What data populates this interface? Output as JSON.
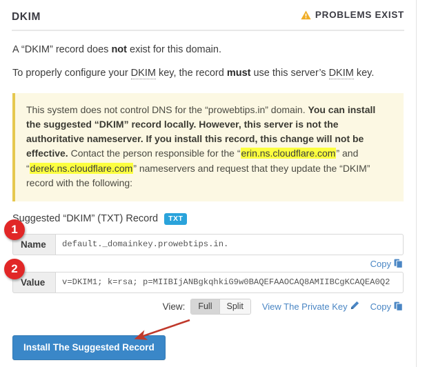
{
  "header": {
    "title": "DKIM",
    "status_label": "PROBLEMS EXIST",
    "status_icon": "warning-triangle-icon",
    "status_color": "#f0ad26"
  },
  "intro": {
    "line1_a": "A “DKIM” record does ",
    "line1_bold": "not",
    "line1_b": " exist for this domain.",
    "line2_a": "To properly configure your ",
    "line2_abbr1": "DKIM",
    "line2_b": " key, the record ",
    "line2_bold": "must",
    "line2_c": " use this server’s ",
    "line2_abbr2": "DKIM",
    "line2_d": " key."
  },
  "callout": {
    "t1": "This system does not control DNS for the “prowebtips.in” domain. ",
    "t2_bold": "You can install the suggested “DKIM” record locally. However, this server is not the authoritative nameserver. If you install this record, this change will not be effective.",
    "t3": " Contact the person responsible for the “",
    "ns1": "erin.ns.cloudflare.com",
    "t4": "” and “",
    "ns2": "derek.ns.cloudflare.com",
    "t5": "” nameservers and request that they update the “DKIM” record with the following:",
    "background_color": "#fcf8e3",
    "border_color": "#e6c84f",
    "highlight_color": "#fcff3f"
  },
  "suggested": {
    "title": "Suggested “DKIM” (TXT) Record",
    "badge": "TXT",
    "badge_color": "#2aa3db"
  },
  "fields": {
    "name": {
      "label": "Name",
      "value": "default._domainkey.prowebtips.in.",
      "marker": "1"
    },
    "value": {
      "label": "Value",
      "value": "v=DKIM1; k=rsa; p=MIIBIjANBgkqhkiG9w0BAQEFAAOCAQ8AMIIBCgKCAQEA0Q2",
      "marker": "2"
    }
  },
  "actions": {
    "copy_label": "Copy",
    "copy_icon": "clipboard-copy-icon",
    "view_label": "View:",
    "view_full": "Full",
    "view_split": "Split",
    "view_selected": "Full",
    "private_key_label": "View The Private Key",
    "private_key_icon": "pencil-edit-icon",
    "install_label": "Install The Suggested Record",
    "install_color": "#3a87c8"
  },
  "annotation": {
    "marker_color": "#e12727",
    "arrow_color": "#c0392b"
  }
}
